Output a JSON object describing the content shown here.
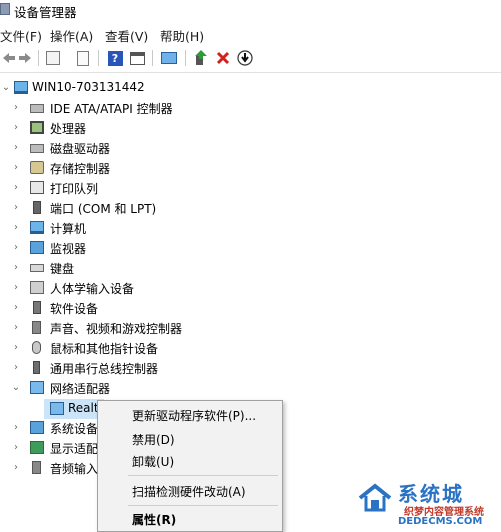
{
  "window": {
    "title": "设备管理器"
  },
  "menubar": {
    "items": [
      {
        "label": "文件(F)"
      },
      {
        "label": "操作(A)"
      },
      {
        "label": "查看(V)"
      },
      {
        "label": "帮助(H)"
      }
    ]
  },
  "toolbar": {
    "icons": [
      "back-arrow-icon",
      "forward-arrow-icon",
      "properties-icon",
      "document-icon",
      "help-icon",
      "view-window-icon",
      "scan-monitor-icon",
      "update-driver-icon",
      "uninstall-x-icon",
      "download-icon"
    ],
    "uninstall_color": "#d0211c",
    "update_color": "#2e9b3a"
  },
  "tree": {
    "root": {
      "label": "WIN10-703131442",
      "expanded": true
    },
    "categories": [
      {
        "label": "IDE ATA/ATAPI 控制器",
        "icon": "ide-controller-icon"
      },
      {
        "label": "处理器",
        "icon": "processor-icon"
      },
      {
        "label": "磁盘驱动器",
        "icon": "disk-drive-icon"
      },
      {
        "label": "存储控制器",
        "icon": "storage-controller-icon"
      },
      {
        "label": "打印队列",
        "icon": "print-queue-icon"
      },
      {
        "label": "端口 (COM 和 LPT)",
        "icon": "port-icon"
      },
      {
        "label": "计算机",
        "icon": "computer-icon"
      },
      {
        "label": "监视器",
        "icon": "monitor-icon"
      },
      {
        "label": "键盘",
        "icon": "keyboard-icon"
      },
      {
        "label": "人体学输入设备",
        "icon": "hid-icon"
      },
      {
        "label": "软件设备",
        "icon": "software-device-icon"
      },
      {
        "label": "声音、视频和游戏控制器",
        "icon": "sound-video-icon"
      },
      {
        "label": "鼠标和其他指针设备",
        "icon": "mouse-icon"
      },
      {
        "label": "通用串行总线控制器",
        "icon": "usb-controller-icon"
      },
      {
        "label": "网络适配器",
        "icon": "network-adapter-icon",
        "expanded": true
      }
    ],
    "network_child": {
      "label": "Realt"
    },
    "after_categories": [
      {
        "label": "系统设备",
        "icon": "system-device-icon"
      },
      {
        "label": "显示适配",
        "icon": "display-adapter-icon"
      },
      {
        "label": "音频输入",
        "icon": "audio-input-icon"
      }
    ]
  },
  "context_menu": {
    "items": [
      {
        "label": "更新驱动程序软件(P)..."
      },
      {
        "label": "禁用(D)"
      },
      {
        "label": "卸载(U)"
      },
      {
        "label": "扫描检测硬件改动(A)"
      },
      {
        "label": "属性(R)"
      }
    ]
  },
  "watermark": {
    "brand": "系统城",
    "sub": "织梦内容管理系统",
    "url": "DEDECMS.COM"
  }
}
